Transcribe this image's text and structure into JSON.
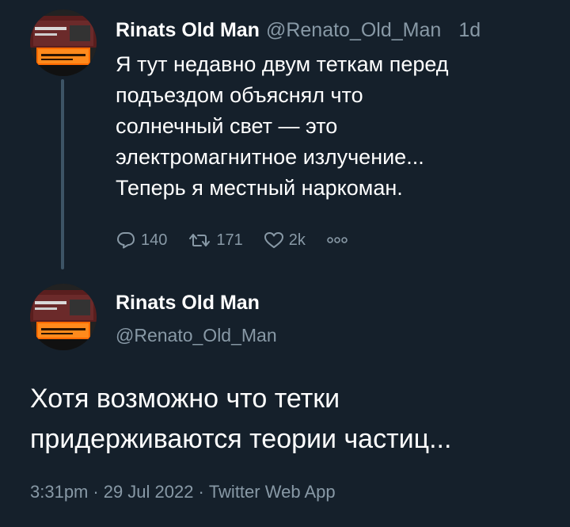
{
  "colors": {
    "background": "#15202b",
    "primary_text": "#ffffff",
    "secondary_text": "#8899a6",
    "thread_line": "#3d5466"
  },
  "reply_tweet": {
    "author": {
      "display_name": "Rinats Old Man",
      "handle": "@Renato_Old_Man",
      "avatar_icon": "avatar-icon"
    },
    "time_ago": "1d",
    "body_lines": [
      "Я тут недавно двум теткам перед",
      "подъездом объяснял что",
      "солнечный свет — это",
      "электромагнитное излучение...",
      "Теперь я местный наркоман."
    ],
    "actions": {
      "reply_count": "140",
      "retweet_count": "171",
      "like_count": "2k"
    }
  },
  "main_tweet": {
    "author": {
      "display_name": "Rinats Old Man",
      "handle": "@Renato_Old_Man",
      "avatar_icon": "avatar-icon"
    },
    "text_lines": [
      "Хотя возможно что тетки",
      "придерживаются теории частиц..."
    ],
    "meta": {
      "time": "3:31pm",
      "date": "29 Jul 2022",
      "source": "Twitter Web App",
      "separator": "·"
    }
  }
}
